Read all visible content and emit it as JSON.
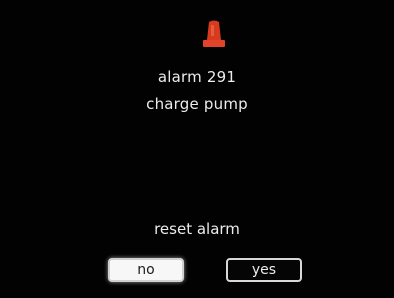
{
  "colors": {
    "background": "#020202",
    "text": "#ececec",
    "alarm_icon": "#d73b1e",
    "selected_button_bg": "#f7f7f7",
    "selected_button_text": "#1c1c1c"
  },
  "alarm": {
    "icon": "alarm-light-icon",
    "code": "alarm 291",
    "description": "charge pump"
  },
  "dialog": {
    "prompt": "reset alarm",
    "buttons": {
      "no": {
        "label": "no",
        "selected": true
      },
      "yes": {
        "label": "yes",
        "selected": false
      }
    }
  }
}
